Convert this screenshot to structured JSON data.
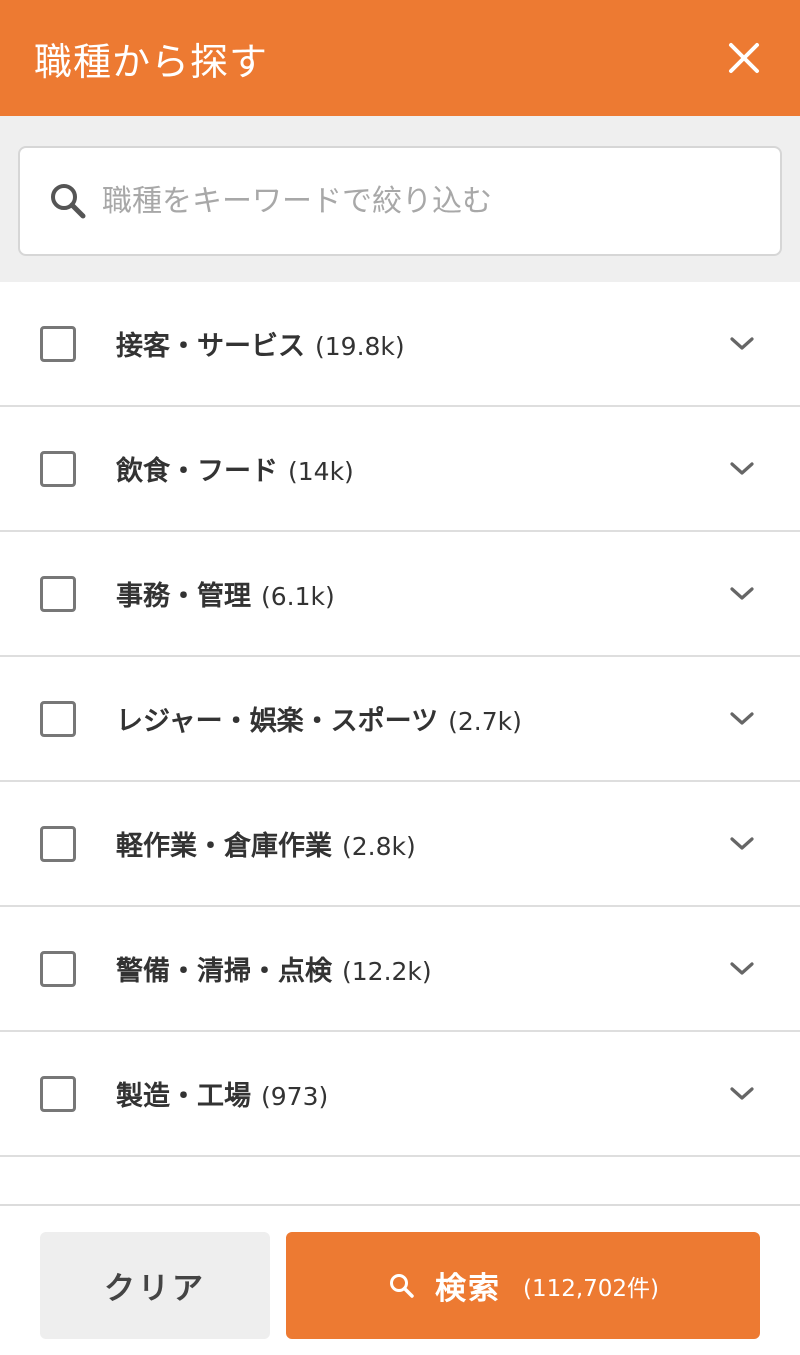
{
  "colors": {
    "accent": "#ED7A32",
    "search_area_bg": "#EFEFEF",
    "clear_button_bg": "#EEEEEE"
  },
  "header": {
    "title": "職種から探す",
    "close_icon": "close-icon"
  },
  "search": {
    "placeholder": "職種をキーワードで絞り込む",
    "value": "",
    "icon": "search-icon"
  },
  "categories": [
    {
      "label": "接客・サービス",
      "count": "(19.8k)",
      "checked": false
    },
    {
      "label": "飲食・フード",
      "count": "(14k)",
      "checked": false
    },
    {
      "label": "事務・管理",
      "count": "(6.1k)",
      "checked": false
    },
    {
      "label": "レジャー・娯楽・スポーツ",
      "count": "(2.7k)",
      "checked": false
    },
    {
      "label": "軽作業・倉庫作業",
      "count": "(2.8k)",
      "checked": false
    },
    {
      "label": "警備・清掃・点検",
      "count": "(12.2k)",
      "checked": false
    },
    {
      "label": "製造・工場",
      "count": "(973)",
      "checked": false
    }
  ],
  "footer": {
    "clear_label": "クリア",
    "search_label": "検索",
    "search_count": "(112,702件)"
  }
}
